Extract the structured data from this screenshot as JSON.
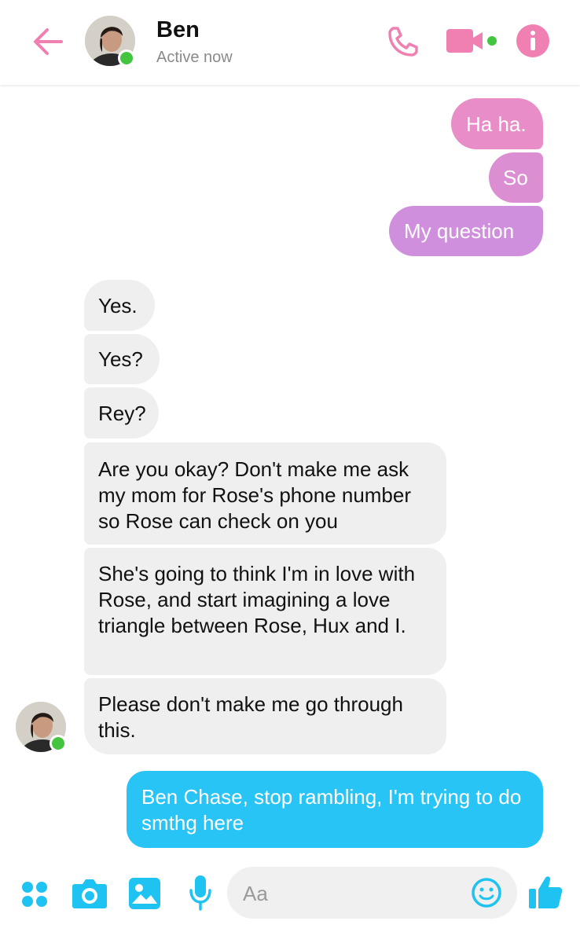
{
  "header": {
    "contact_name": "Ben",
    "status": "Active now",
    "back_icon": "arrow-left-icon",
    "call_icon": "phone-icon",
    "video_icon": "video-camera-icon",
    "info_icon": "info-icon",
    "accent_color": "#f07fb2"
  },
  "messages": [
    {
      "side": "out",
      "text": "Ha ha."
    },
    {
      "side": "out",
      "text": "So"
    },
    {
      "side": "out",
      "text": "My question"
    },
    {
      "side": "in",
      "text": "Yes."
    },
    {
      "side": "in",
      "text": "Yes?"
    },
    {
      "side": "in",
      "text": "Rey?"
    },
    {
      "side": "in",
      "text": "Are you okay? Don't make me ask my mom for Rose's phone number so Rose can check on you"
    },
    {
      "side": "in",
      "text": "She's going to think I'm in love with Rose, and start imagining a love triangle between Rose, Hux and I."
    },
    {
      "side": "in",
      "text": "Please don't make me go through this."
    },
    {
      "side": "out",
      "text": "Ben Chase, stop rambling, I'm trying to do smthg here"
    }
  ],
  "composer": {
    "placeholder": "Aa",
    "icons": [
      "apps-icon",
      "camera-icon",
      "image-icon",
      "microphone-icon",
      "emoji-icon",
      "thumbs-up-icon"
    ],
    "accent_color": "#1ec3f2"
  }
}
